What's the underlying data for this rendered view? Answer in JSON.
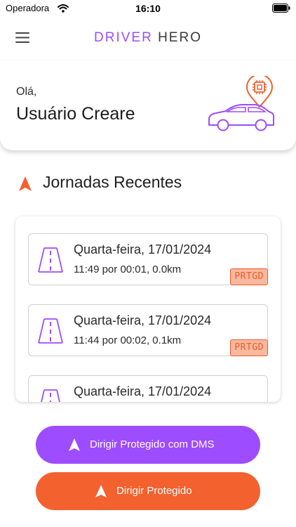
{
  "status_bar": {
    "carrier": "Operadora",
    "time": "16:10"
  },
  "header": {
    "brand_accent": "DRIVER",
    "brand_rest": "HERO"
  },
  "welcome": {
    "greeting": "Olá,",
    "username": "Usuário Creare"
  },
  "journeys": {
    "title": "Jornadas Recentes",
    "items": [
      {
        "date": "Quarta-feira, 17/01/2024",
        "details": "11:49 por 00:01, 0.0km",
        "badge": "PRTGD"
      },
      {
        "date": "Quarta-feira, 17/01/2024",
        "details": "11:44 por 00:02, 0.1km",
        "badge": "PRTGD"
      },
      {
        "date": "Quarta-feira, 17/01/2024",
        "details": "",
        "badge": ""
      }
    ]
  },
  "actions": {
    "dms_label": "Dirigir Protegido com DMS",
    "protected_label": "Dirigir Protegido"
  },
  "colors": {
    "purple": "#9d4cff",
    "orange": "#f2612e",
    "badge_bg": "#f9b99e"
  },
  "icons": [
    "wifi-icon",
    "battery-icon",
    "menu-icon",
    "car-chip-icon",
    "nav-arrow-icon",
    "road-icon"
  ]
}
